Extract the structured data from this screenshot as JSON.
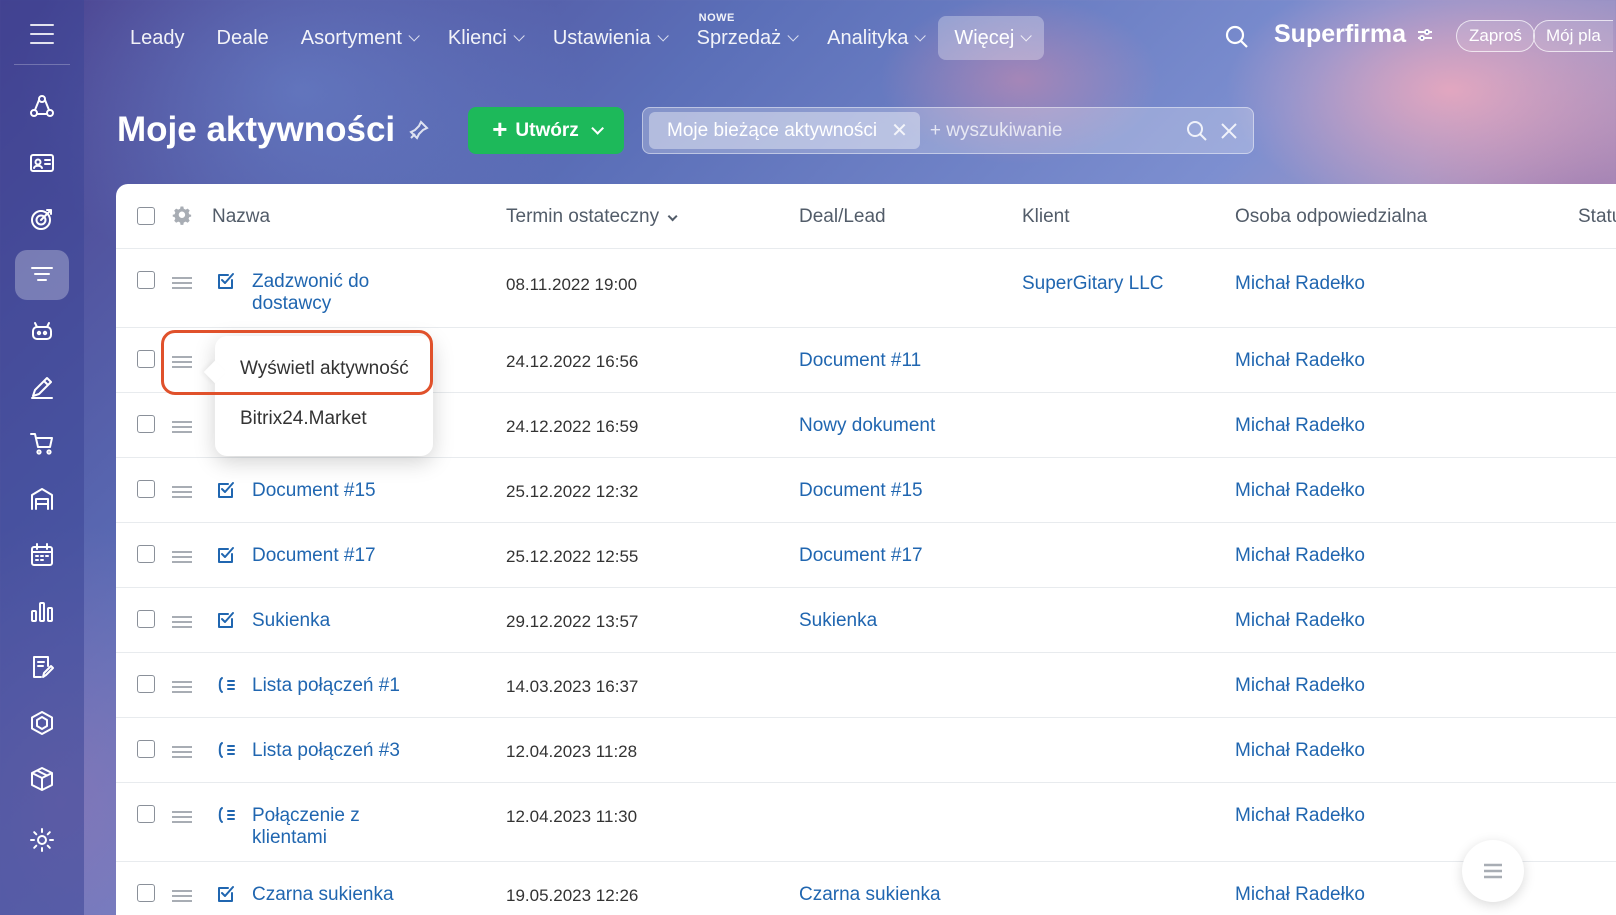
{
  "topnav": {
    "items": [
      {
        "label": "Leady",
        "chevron": false
      },
      {
        "label": "Deale",
        "chevron": false
      },
      {
        "label": "Asortyment",
        "chevron": true
      },
      {
        "label": "Klienci",
        "chevron": true
      },
      {
        "label": "Ustawienia",
        "chevron": true
      },
      {
        "label": "Sprzedaż",
        "chevron": true,
        "badge": "NOWE"
      },
      {
        "label": "Analityka",
        "chevron": true
      },
      {
        "label": "Więcej",
        "chevron": true,
        "active": true
      }
    ],
    "company": "Superfirma",
    "invite_label": "Zaproś",
    "plan_label": "Mój pla"
  },
  "page": {
    "title": "Moje aktywności",
    "create_label": "Utwórz",
    "filter_tag": "Moje bieżące aktywności",
    "search_placeholder": "+ wyszukiwanie"
  },
  "grid": {
    "columns": {
      "name": "Nazwa",
      "deadline": "Termin ostateczny",
      "deal": "Deal/Lead",
      "client": "Klient",
      "owner": "Osoba odpowiedzialna",
      "status": "Statu"
    },
    "rows": [
      {
        "type": "task",
        "name": "Zadzwonić do dostawcy",
        "deadline": "08.11.2022 19:00",
        "deal": "",
        "client": "SuperGitary LLC",
        "owner": "Michał Radełko"
      },
      {
        "type": "",
        "name": "",
        "deadline": "24.12.2022 16:56",
        "deal": "Document #11",
        "client": "",
        "owner": "Michał Radełko"
      },
      {
        "type": "",
        "name": "",
        "deadline": "24.12.2022 16:59",
        "deal": "Nowy dokument",
        "client": "",
        "owner": "Michał Radełko"
      },
      {
        "type": "task",
        "name": "Document #15",
        "deadline": "25.12.2022 12:32",
        "deal": "Document #15",
        "client": "",
        "owner": "Michał Radełko"
      },
      {
        "type": "task",
        "name": "Document #17",
        "deadline": "25.12.2022 12:55",
        "deal": "Document #17",
        "client": "",
        "owner": "Michał Radełko"
      },
      {
        "type": "task",
        "name": "Sukienka",
        "deadline": "29.12.2022 13:57",
        "deal": "Sukienka",
        "client": "",
        "owner": "Michał Radełko"
      },
      {
        "type": "call",
        "name": "Lista połączeń #1",
        "deadline": "14.03.2023 16:37",
        "deal": "",
        "client": "",
        "owner": "Michał Radełko"
      },
      {
        "type": "call",
        "name": "Lista połączeń #3",
        "deadline": "12.04.2023 11:28",
        "deal": "",
        "client": "",
        "owner": "Michał Radełko"
      },
      {
        "type": "call",
        "name": "Połączenie z klientami",
        "deadline": "12.04.2023 11:30",
        "deal": "",
        "client": "",
        "owner": "Michał Radełko"
      },
      {
        "type": "task",
        "name": "Czarna sukienka",
        "deadline": "19.05.2023 12:26",
        "deal": "Czarna sukienka",
        "client": "",
        "owner": "Michał Radełko"
      }
    ]
  },
  "context_menu": {
    "items": [
      "Wyświetl aktywność",
      "Bitrix24.Market"
    ]
  },
  "colors": {
    "accent_green": "#1db95a",
    "link_blue": "#2066b0",
    "highlight_orange": "#e0512b"
  }
}
